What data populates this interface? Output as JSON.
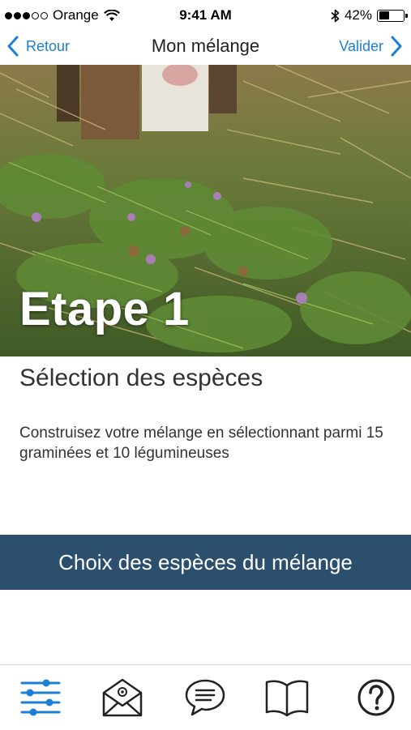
{
  "status_bar": {
    "carrier": "Orange",
    "time": "9:41 AM",
    "battery_percent": "42%",
    "battery_level": 0.42,
    "signal_strength": 3,
    "icons": [
      "wifi-icon",
      "bluetooth-icon",
      "battery-icon"
    ]
  },
  "nav": {
    "back_label": "Retour",
    "title": "Mon mélange",
    "validate_label": "Valider"
  },
  "hero": {
    "step_label": "Etape 1"
  },
  "content": {
    "title": "Sélection des espèces",
    "description": "Construisez votre mélange en sélectionnant parmi 15 graminées et 10 légumineuses"
  },
  "cta": {
    "label": "Choix des espèces du mélange"
  },
  "tab_bar": {
    "items": [
      "settings-sliders-icon",
      "email-icon",
      "chat-icon",
      "book-icon",
      "help-icon"
    ]
  },
  "colors": {
    "accent": "#1a7fd6",
    "cta_background": "#2d4f6e",
    "active_tab": "#1a7fd6"
  }
}
